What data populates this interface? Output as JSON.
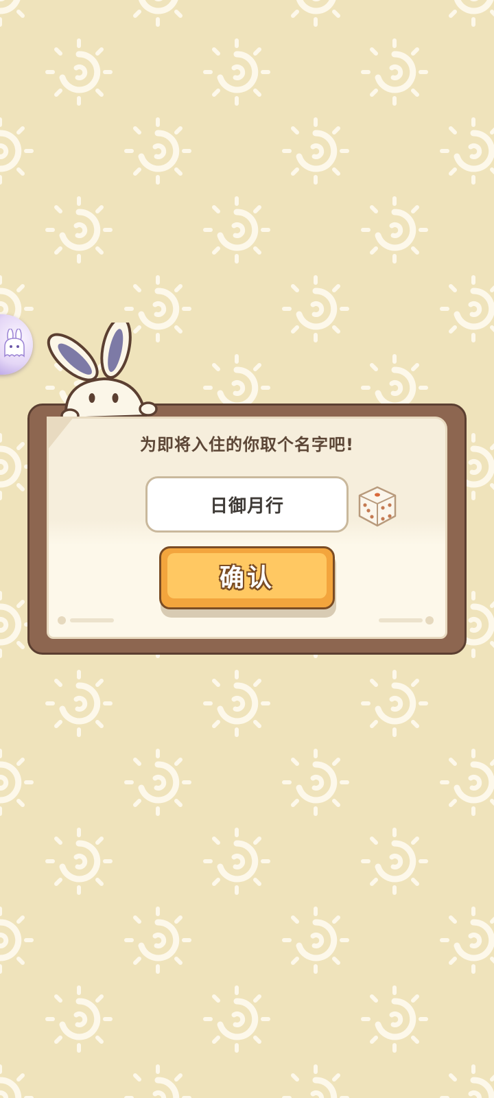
{
  "dialog": {
    "title": "为即将入住的你取个名字吧!",
    "name_value": "日御月行",
    "confirm_label": "确认"
  },
  "colors": {
    "background": "#efe3bb",
    "sun_pattern": "#fdf8ea",
    "frame": "#8d6650",
    "paper": "#f6eedc",
    "button": "#f3a53d",
    "button_outline": "#7a4c24"
  },
  "icons": {
    "background_pattern": "sun-icon",
    "randomize": "dice-icon",
    "mascot": "bunny-icon",
    "assistant": "ghost-bunny-icon"
  }
}
